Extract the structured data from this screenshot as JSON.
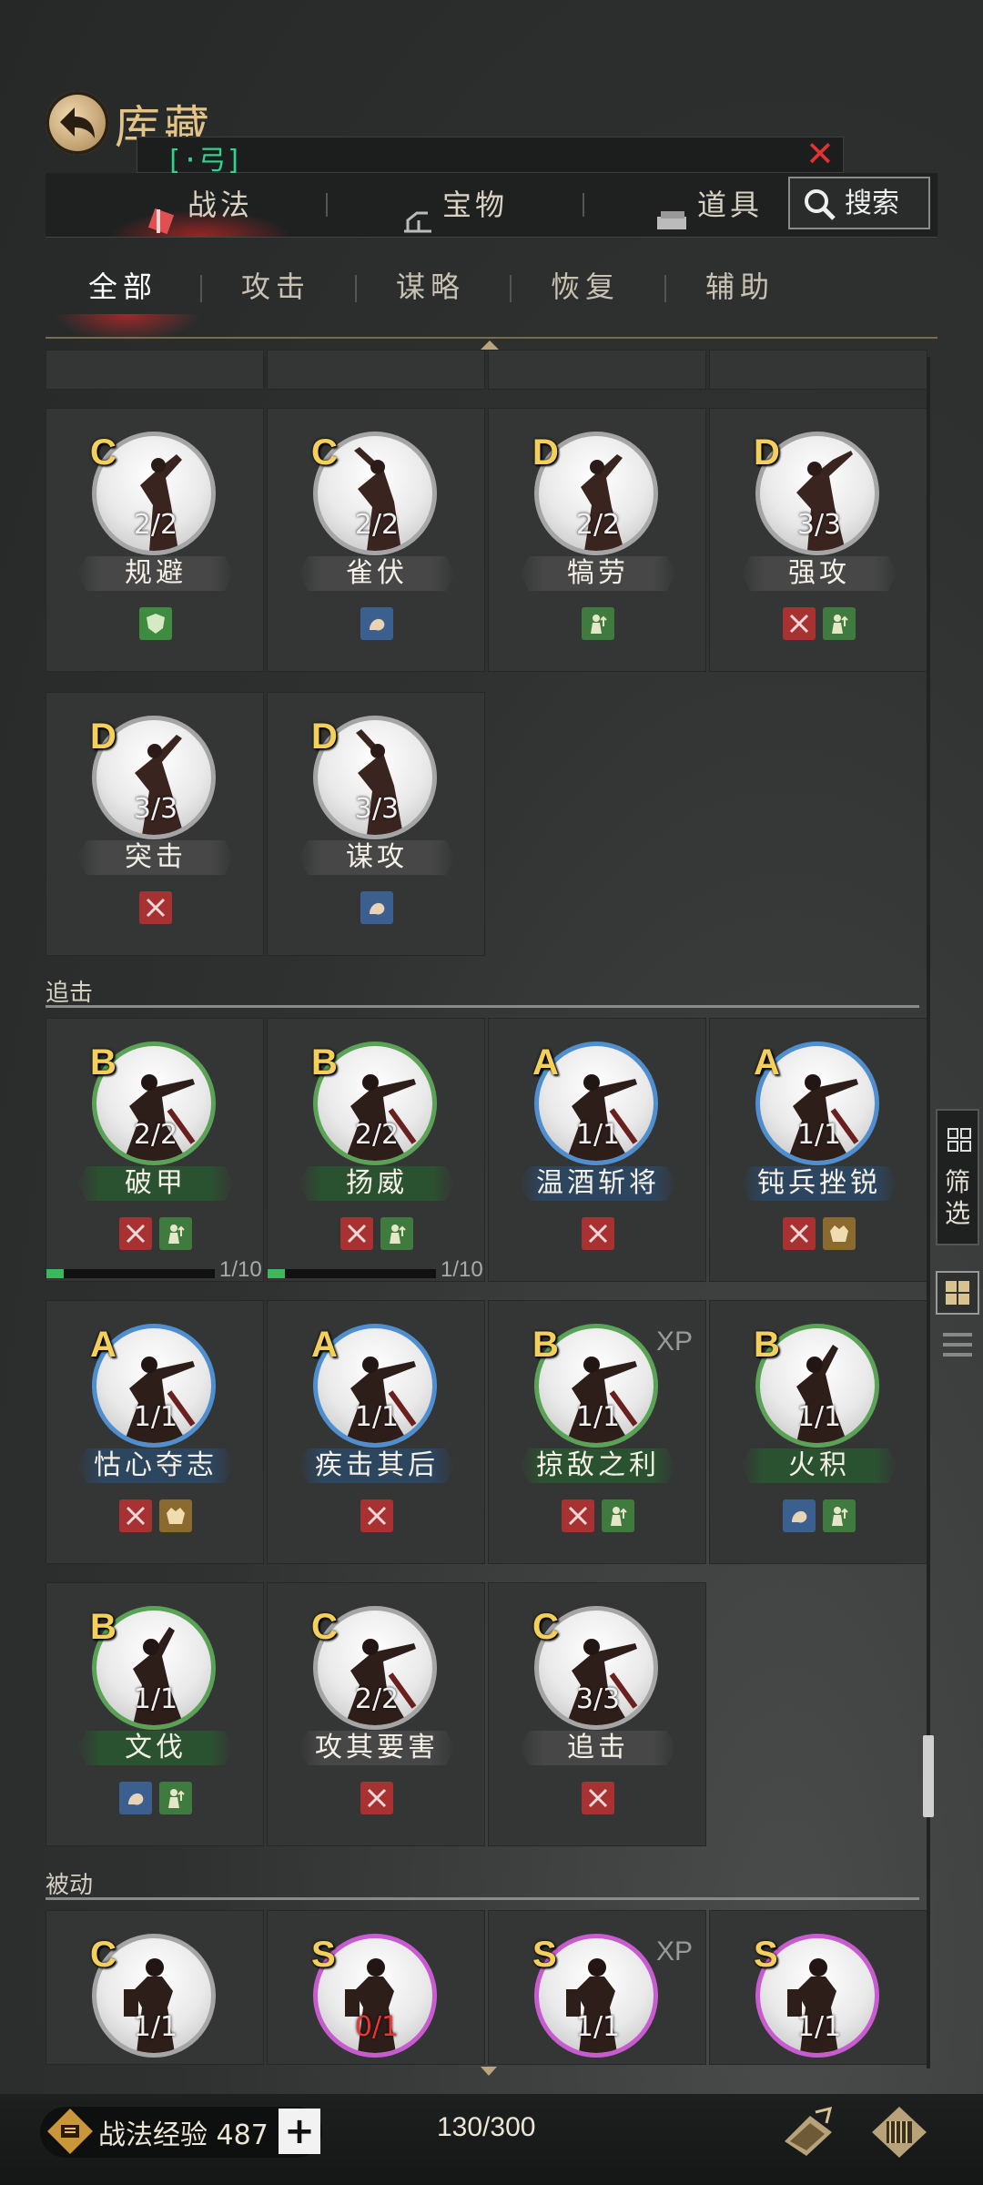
{
  "header": {
    "title": "库藏",
    "search_text": "[·弓]",
    "tabs": [
      {
        "label": "战法",
        "active": true
      },
      {
        "label": "宝物",
        "active": false
      },
      {
        "label": "道具",
        "active": false
      }
    ],
    "search_button": "搜索"
  },
  "subtabs": [
    {
      "label": "全部",
      "active": true
    },
    {
      "label": "攻击",
      "active": false
    },
    {
      "label": "谋略",
      "active": false
    },
    {
      "label": "恢复",
      "active": false
    },
    {
      "label": "辅助",
      "active": false
    }
  ],
  "sections": {
    "group1_row1": [
      {
        "grade": "C",
        "count": "2/2",
        "name": "规避",
        "icons": [
          "shield-icon"
        ]
      },
      {
        "grade": "C",
        "count": "2/2",
        "name": "雀伏",
        "icons": [
          "strategy-icon"
        ]
      },
      {
        "grade": "D",
        "count": "2/2",
        "name": "犒劳",
        "icons": [
          "troop-icon"
        ]
      },
      {
        "grade": "D",
        "count": "3/3",
        "name": "强攻",
        "icons": [
          "attack-icon",
          "troop-icon"
        ]
      }
    ],
    "group1_row2": [
      {
        "grade": "D",
        "count": "3/3",
        "name": "突击",
        "icons": [
          "attack-icon"
        ]
      },
      {
        "grade": "D",
        "count": "3/3",
        "name": "谋攻",
        "icons": [
          "strategy-icon"
        ]
      }
    ],
    "pursuit": {
      "title": "追击",
      "row1": [
        {
          "grade": "B",
          "count": "2/2",
          "name": "破甲",
          "icons": [
            "attack-icon",
            "troop-icon"
          ],
          "progress": "1/10",
          "progress_value": 0.1
        },
        {
          "grade": "B",
          "count": "2/2",
          "name": "扬威",
          "icons": [
            "attack-icon",
            "troop-icon"
          ],
          "progress": "1/10",
          "progress_value": 0.1
        },
        {
          "grade": "A",
          "count": "1/1",
          "name": "温酒斩将",
          "icons": [
            "attack-icon"
          ]
        },
        {
          "grade": "A",
          "count": "1/1",
          "name": "钝兵挫锐",
          "icons": [
            "attack-icon",
            "beast-icon"
          ]
        }
      ],
      "row2": [
        {
          "grade": "A",
          "count": "1/1",
          "name": "怙心夺志",
          "icons": [
            "attack-icon",
            "beast-icon"
          ]
        },
        {
          "grade": "A",
          "count": "1/1",
          "name": "疾击其后",
          "icons": [
            "attack-icon"
          ]
        },
        {
          "grade": "B",
          "count": "1/1",
          "name": "掠敌之利",
          "icons": [
            "attack-icon",
            "troop-icon"
          ],
          "badge": "XP"
        },
        {
          "grade": "B",
          "count": "1/1",
          "name": "火积",
          "icons": [
            "strategy-icon",
            "troop-icon"
          ]
        }
      ],
      "row3": [
        {
          "grade": "B",
          "count": "1/1",
          "name": "文伐",
          "icons": [
            "strategy-icon",
            "troop-icon"
          ]
        },
        {
          "grade": "C",
          "count": "2/2",
          "name": "攻其要害",
          "icons": [
            "attack-icon"
          ]
        },
        {
          "grade": "C",
          "count": "3/3",
          "name": "追击",
          "icons": [
            "attack-icon"
          ]
        }
      ]
    },
    "passive": {
      "title": "被动",
      "row1": [
        {
          "grade": "C",
          "count": "1/1"
        },
        {
          "grade": "S",
          "count": "0/1"
        },
        {
          "grade": "S",
          "count": "1/1",
          "badge": "XP"
        },
        {
          "grade": "S",
          "count": "1/1"
        }
      ]
    }
  },
  "side": {
    "filter_label": "筛选"
  },
  "footer": {
    "xp_label": "战法经验 487",
    "plus": "+",
    "capacity": "130/300"
  },
  "colors": {
    "accent_gold": "#e4c486",
    "grade_gold": "#f4cf5a",
    "attack": "#a83232",
    "troop": "#3f7a3f",
    "strategy": "#3b5f8e",
    "beast": "#8a6a2e",
    "search_green": "#33d18c",
    "close_red": "#e23232"
  }
}
